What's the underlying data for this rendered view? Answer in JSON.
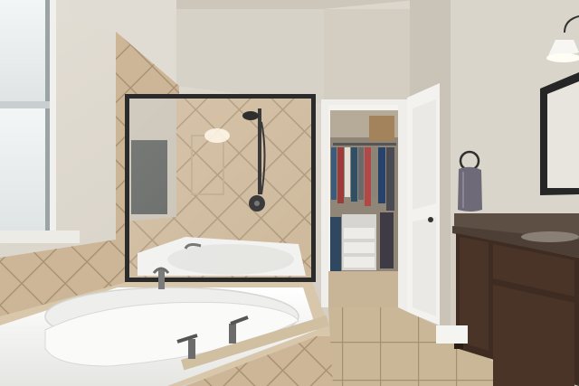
{
  "photo": {
    "kind": "real-estate interior photograph",
    "room": "bathroom"
  },
  "objects": {
    "window": "frosted-window",
    "shower": "glass-shower-enclosure",
    "shower_head": "wall-mounted-shower-head",
    "tub": "corner-garden-tub",
    "closet": "walk-in-closet",
    "door": "open-white-door",
    "vanity": "dark-wood-vanity",
    "mirror": "framed-mirror",
    "light": "pendant-wall-light",
    "towel": "hand-towel-on-ring",
    "floor": "tile-floor"
  },
  "colors": {
    "wall": "#d9d4ca",
    "tile": "#cbb596",
    "tile_grout": "#a99374",
    "tub": "#f6f6f4",
    "cabinet": "#3e2c22",
    "countertop": "#5a4a3c",
    "door": "#f2f1ee",
    "floor": "#c8b597",
    "glass_frame": "#2b2b2b",
    "window_glass": "#e9eef0"
  }
}
